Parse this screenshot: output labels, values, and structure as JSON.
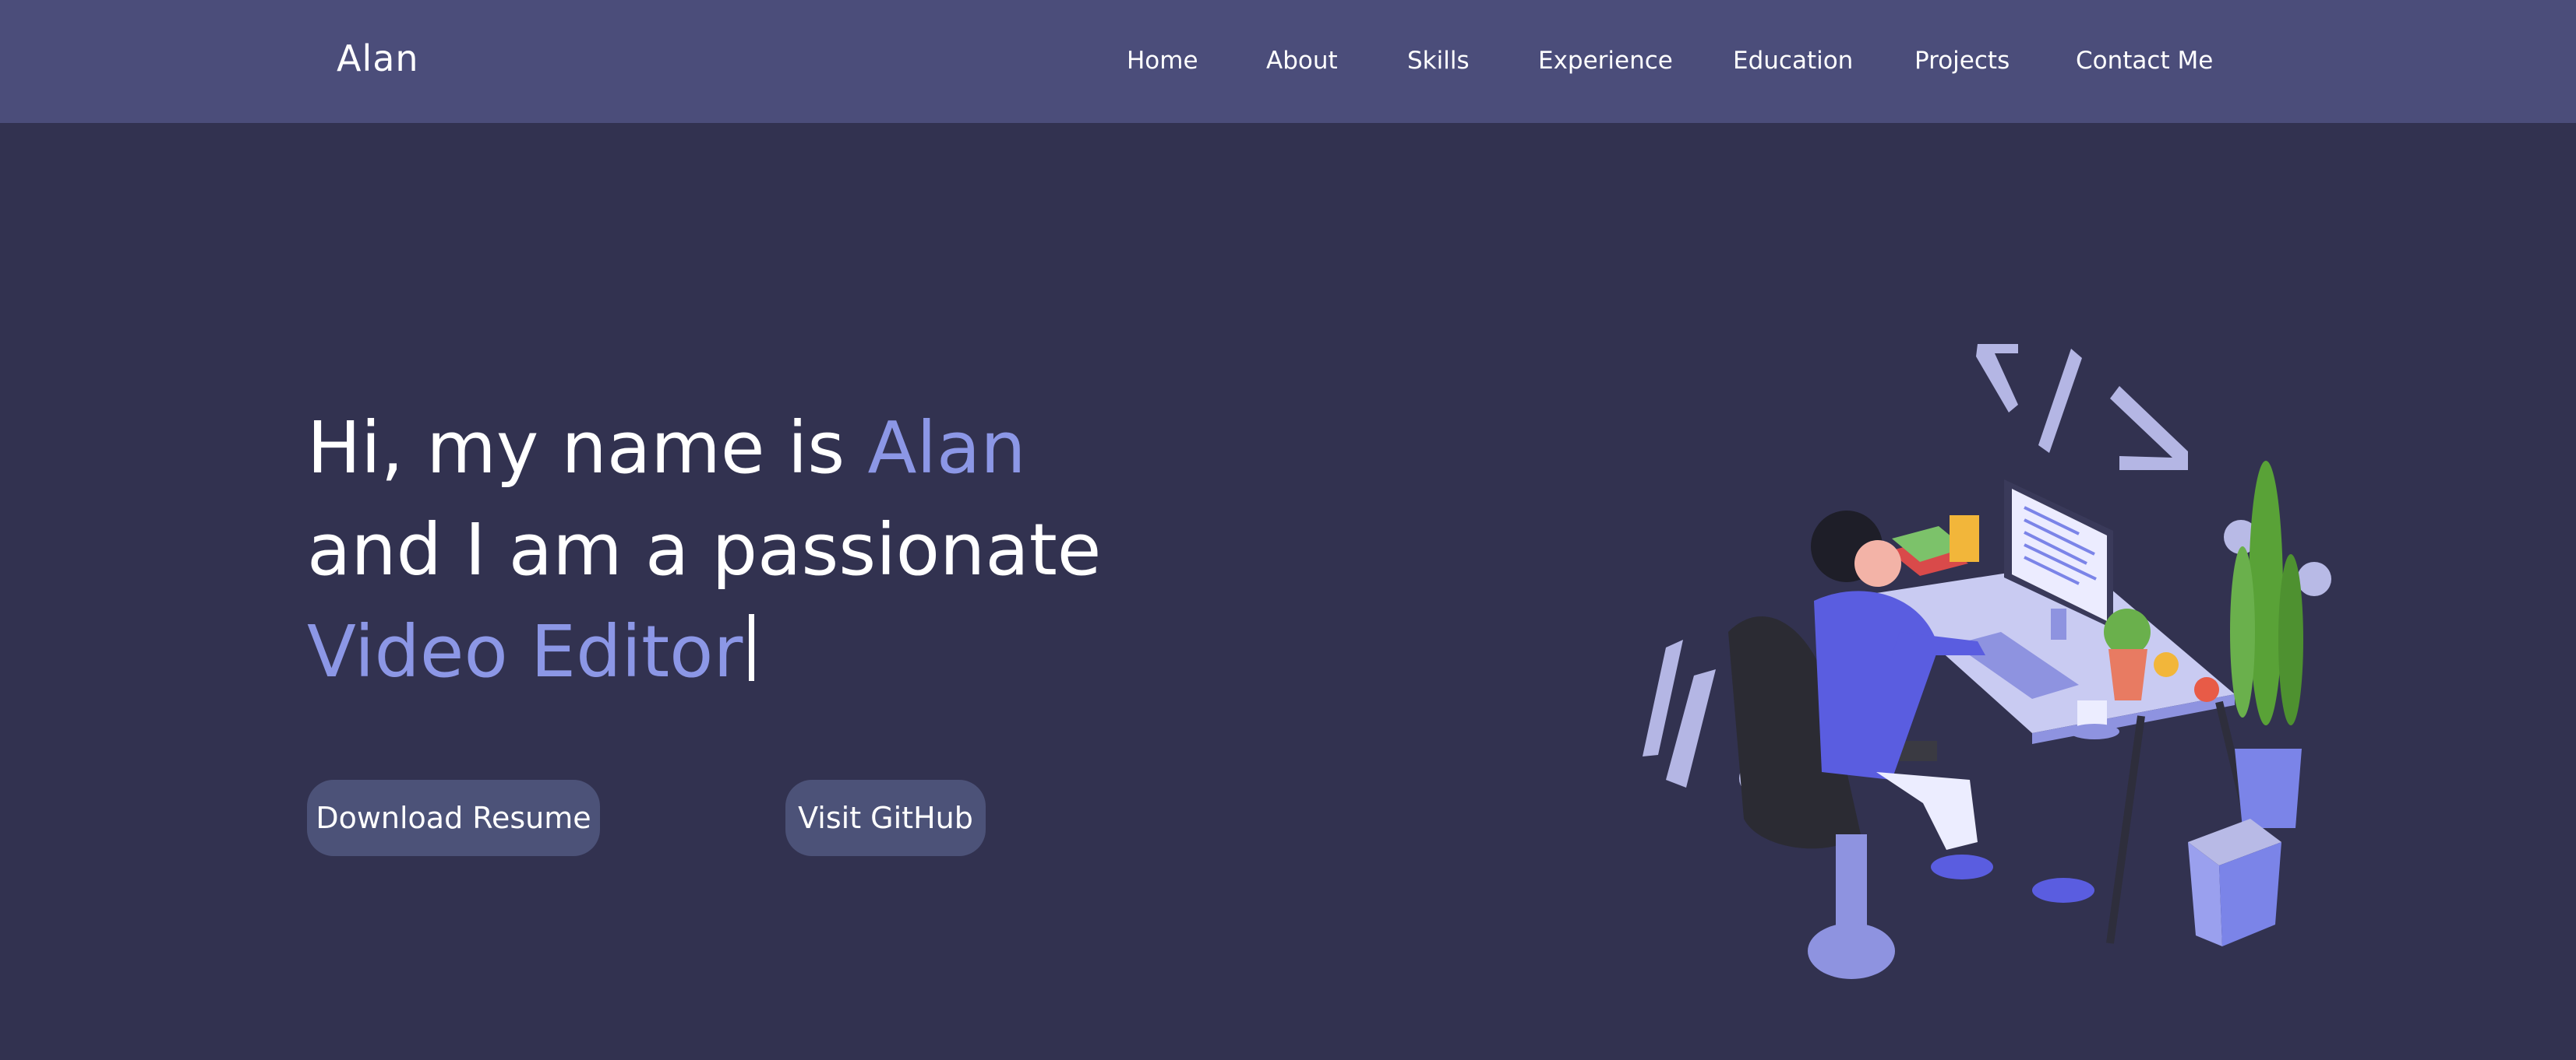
{
  "nav": {
    "brand": "Alan",
    "items": [
      "Home",
      "About",
      "Skills",
      "Experience",
      "Education",
      "Projects",
      "Contact Me"
    ]
  },
  "hero": {
    "line1_prefix": "Hi, my name is ",
    "name": "Alan",
    "line2": "and I am a passionate",
    "role": "Video Editor"
  },
  "buttons": {
    "resume": "Download Resume",
    "github": "Visit GitHub"
  },
  "colors": {
    "background": "#323250",
    "navbar": "#4b4d7a",
    "accent": "#8c97e6",
    "button": "#4c5278"
  }
}
